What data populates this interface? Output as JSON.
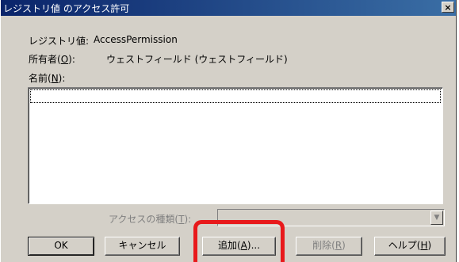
{
  "window": {
    "title": "レジストリ値 のアクセス許可",
    "close_glyph": "×"
  },
  "fields": {
    "registry_label": "レジストリ値:",
    "registry_value": "AccessPermission",
    "owner_label_prefix": "所有者(",
    "owner_label_key": "O",
    "owner_label_suffix": "):",
    "owner_value": "ウェストフィールド (ウェストフィールド)",
    "name_label_prefix": "名前(",
    "name_label_key": "N",
    "name_label_suffix": "):"
  },
  "access": {
    "label_prefix": "アクセスの種類(",
    "label_key": "T",
    "label_suffix": "):",
    "dropdown_arrow": "▼"
  },
  "buttons": {
    "ok": "OK",
    "cancel": "キャンセル",
    "add_prefix": "追加(",
    "add_key": "A",
    "add_suffix": ")...",
    "remove_prefix": "削除(",
    "remove_key": "R",
    "remove_suffix": ")",
    "help_prefix": "ヘルプ(",
    "help_key": "H",
    "help_suffix": ")"
  },
  "annotation": {
    "highlight_color": "#e8191b"
  }
}
